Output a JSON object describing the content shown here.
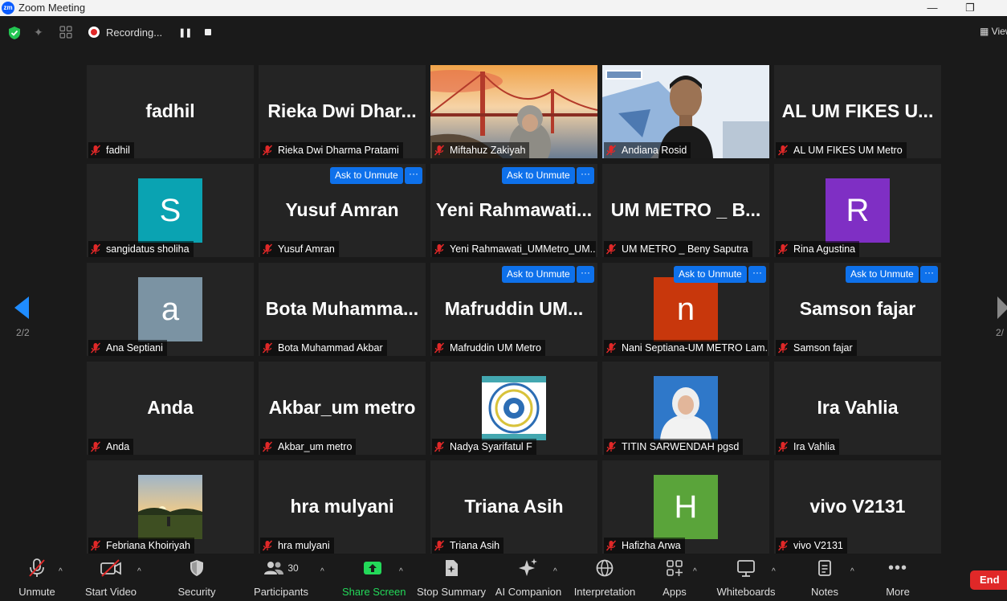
{
  "window": {
    "title": "Zoom Meeting",
    "minimize": "—",
    "restore": "❐"
  },
  "topbar": {
    "recording_label": "Recording...",
    "pause_symbol": "❚❚",
    "view_label": "View"
  },
  "pagination": {
    "left_page": "2/2",
    "right_page": "2/"
  },
  "tile_controls": {
    "ask_to_unmute": "Ask to Unmute",
    "more_dots": "···"
  },
  "tiles": [
    {
      "big": "fadhil",
      "name": "fadhil"
    },
    {
      "big": "Rieka Dwi Dhar...",
      "name": "Rieka Dwi Dharma Pratami"
    },
    {
      "name": "Miftahuz Zakiyah"
    },
    {
      "name": "Andiana Rosid"
    },
    {
      "big": "AL UM FIKES U...",
      "name": "AL UM FIKES UM Metro"
    },
    {
      "avatar": "S",
      "name": "sangidatus sholiha"
    },
    {
      "big": "Yusuf Amran",
      "name": "Yusuf Amran"
    },
    {
      "big": "Yeni Rahmawati...",
      "name": "Yeni Rahmawati_UMMetro_UM..."
    },
    {
      "big": "UM METRO _ B...",
      "name": "UM METRO _ Beny Saputra"
    },
    {
      "avatar": "R",
      "name": "Rina Agustina"
    },
    {
      "avatar": "a",
      "name": "Ana Septiani"
    },
    {
      "big": "Bota Muhamma...",
      "name": "Bota Muhammad Akbar"
    },
    {
      "big": "Mafruddin UM...",
      "name": "Mafruddin UM Metro"
    },
    {
      "avatar": "n",
      "name": "Nani Septiana-UM METRO Lam..."
    },
    {
      "big": "Samson fajar",
      "name": "Samson fajar"
    },
    {
      "big": "Anda",
      "name": "Anda"
    },
    {
      "big": "Akbar_um metro",
      "name": "Akbar_um metro"
    },
    {
      "name": "Nadya Syarifatul F"
    },
    {
      "name": "TITIN SARWENDAH pgsd"
    },
    {
      "big": "Ira Vahlia",
      "name": "Ira Vahlia"
    },
    {
      "name": "Febriana Khoiriyah"
    },
    {
      "big": "hra mulyani",
      "name": "hra mulyani"
    },
    {
      "big": "Triana Asih",
      "name": "Triana Asih"
    },
    {
      "avatar": "H",
      "name": "Hafizha Arwa"
    },
    {
      "big": "vivo V2131",
      "name": "vivo V2131"
    }
  ],
  "toolbar": {
    "unmute": "Unmute",
    "start_video": "Start Video",
    "security": "Security",
    "participants": "Participants",
    "participants_count": "30",
    "share_screen": "Share Screen",
    "stop_summary": "Stop Summary",
    "ai_companion": "AI Companion",
    "interpretation": "Interpretation",
    "apps": "Apps",
    "whiteboards": "Whiteboards",
    "notes": "Notes",
    "more": "More",
    "end": "End",
    "caret": "^"
  },
  "colors": {
    "accent_blue": "#0e71eb",
    "share_green": "#23d959",
    "end_red": "#e02828",
    "avatar_S": "#0aa3b2",
    "avatar_R": "#7f2fc4",
    "avatar_a": "#7b93a3",
    "avatar_n": "#c8370c",
    "avatar_H": "#5aa43a"
  }
}
